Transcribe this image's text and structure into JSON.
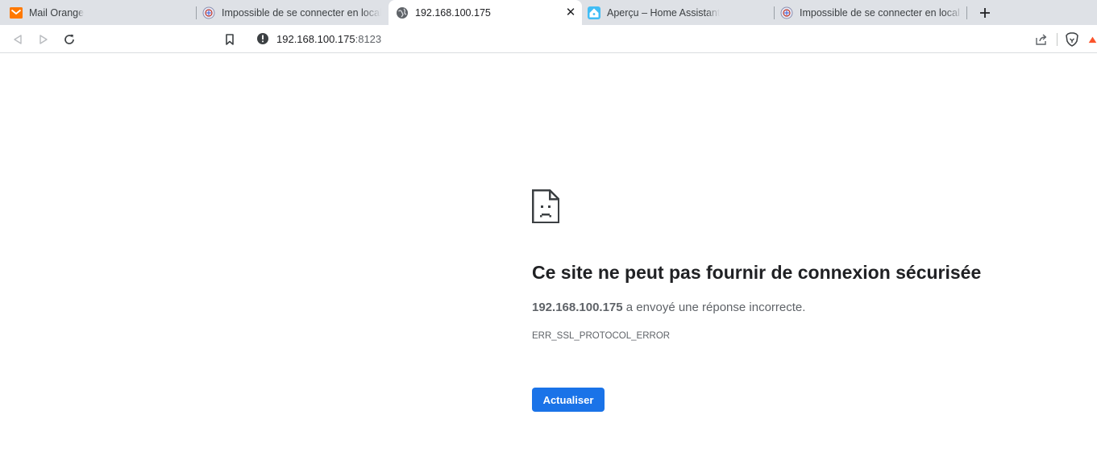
{
  "tabs": [
    {
      "title": "Mail Orange",
      "icon": "mail-orange-icon",
      "active": false
    },
    {
      "title": "Impossible de se connecter en local - Home Assistant",
      "icon": "forum-favicon-icon",
      "active": false
    },
    {
      "title": "192.168.100.175",
      "icon": "globe-icon",
      "active": true
    },
    {
      "title": "Aperçu – Home Assistant",
      "icon": "home-assistant-icon",
      "active": false
    },
    {
      "title": "Impossible de se connecter en local - Home Assistant",
      "icon": "forum-favicon-icon",
      "active": false
    }
  ],
  "omnibox": {
    "host": "192.168.100.175",
    "port": ":8123"
  },
  "error_page": {
    "heading": "Ce site ne peut pas fournir de connexion sécurisée",
    "host": "192.168.100.175",
    "message": " a envoyé une réponse incorrecte.",
    "code": "ERR_SSL_PROTOCOL_ERROR",
    "reload_label": "Actualiser"
  },
  "colors": {
    "tabstrip_bg": "#dee1e6",
    "button_blue": "#1a73e8",
    "text_secondary": "#5f6368",
    "orange": "#ff7900",
    "brave_orange": "#fb542b"
  }
}
